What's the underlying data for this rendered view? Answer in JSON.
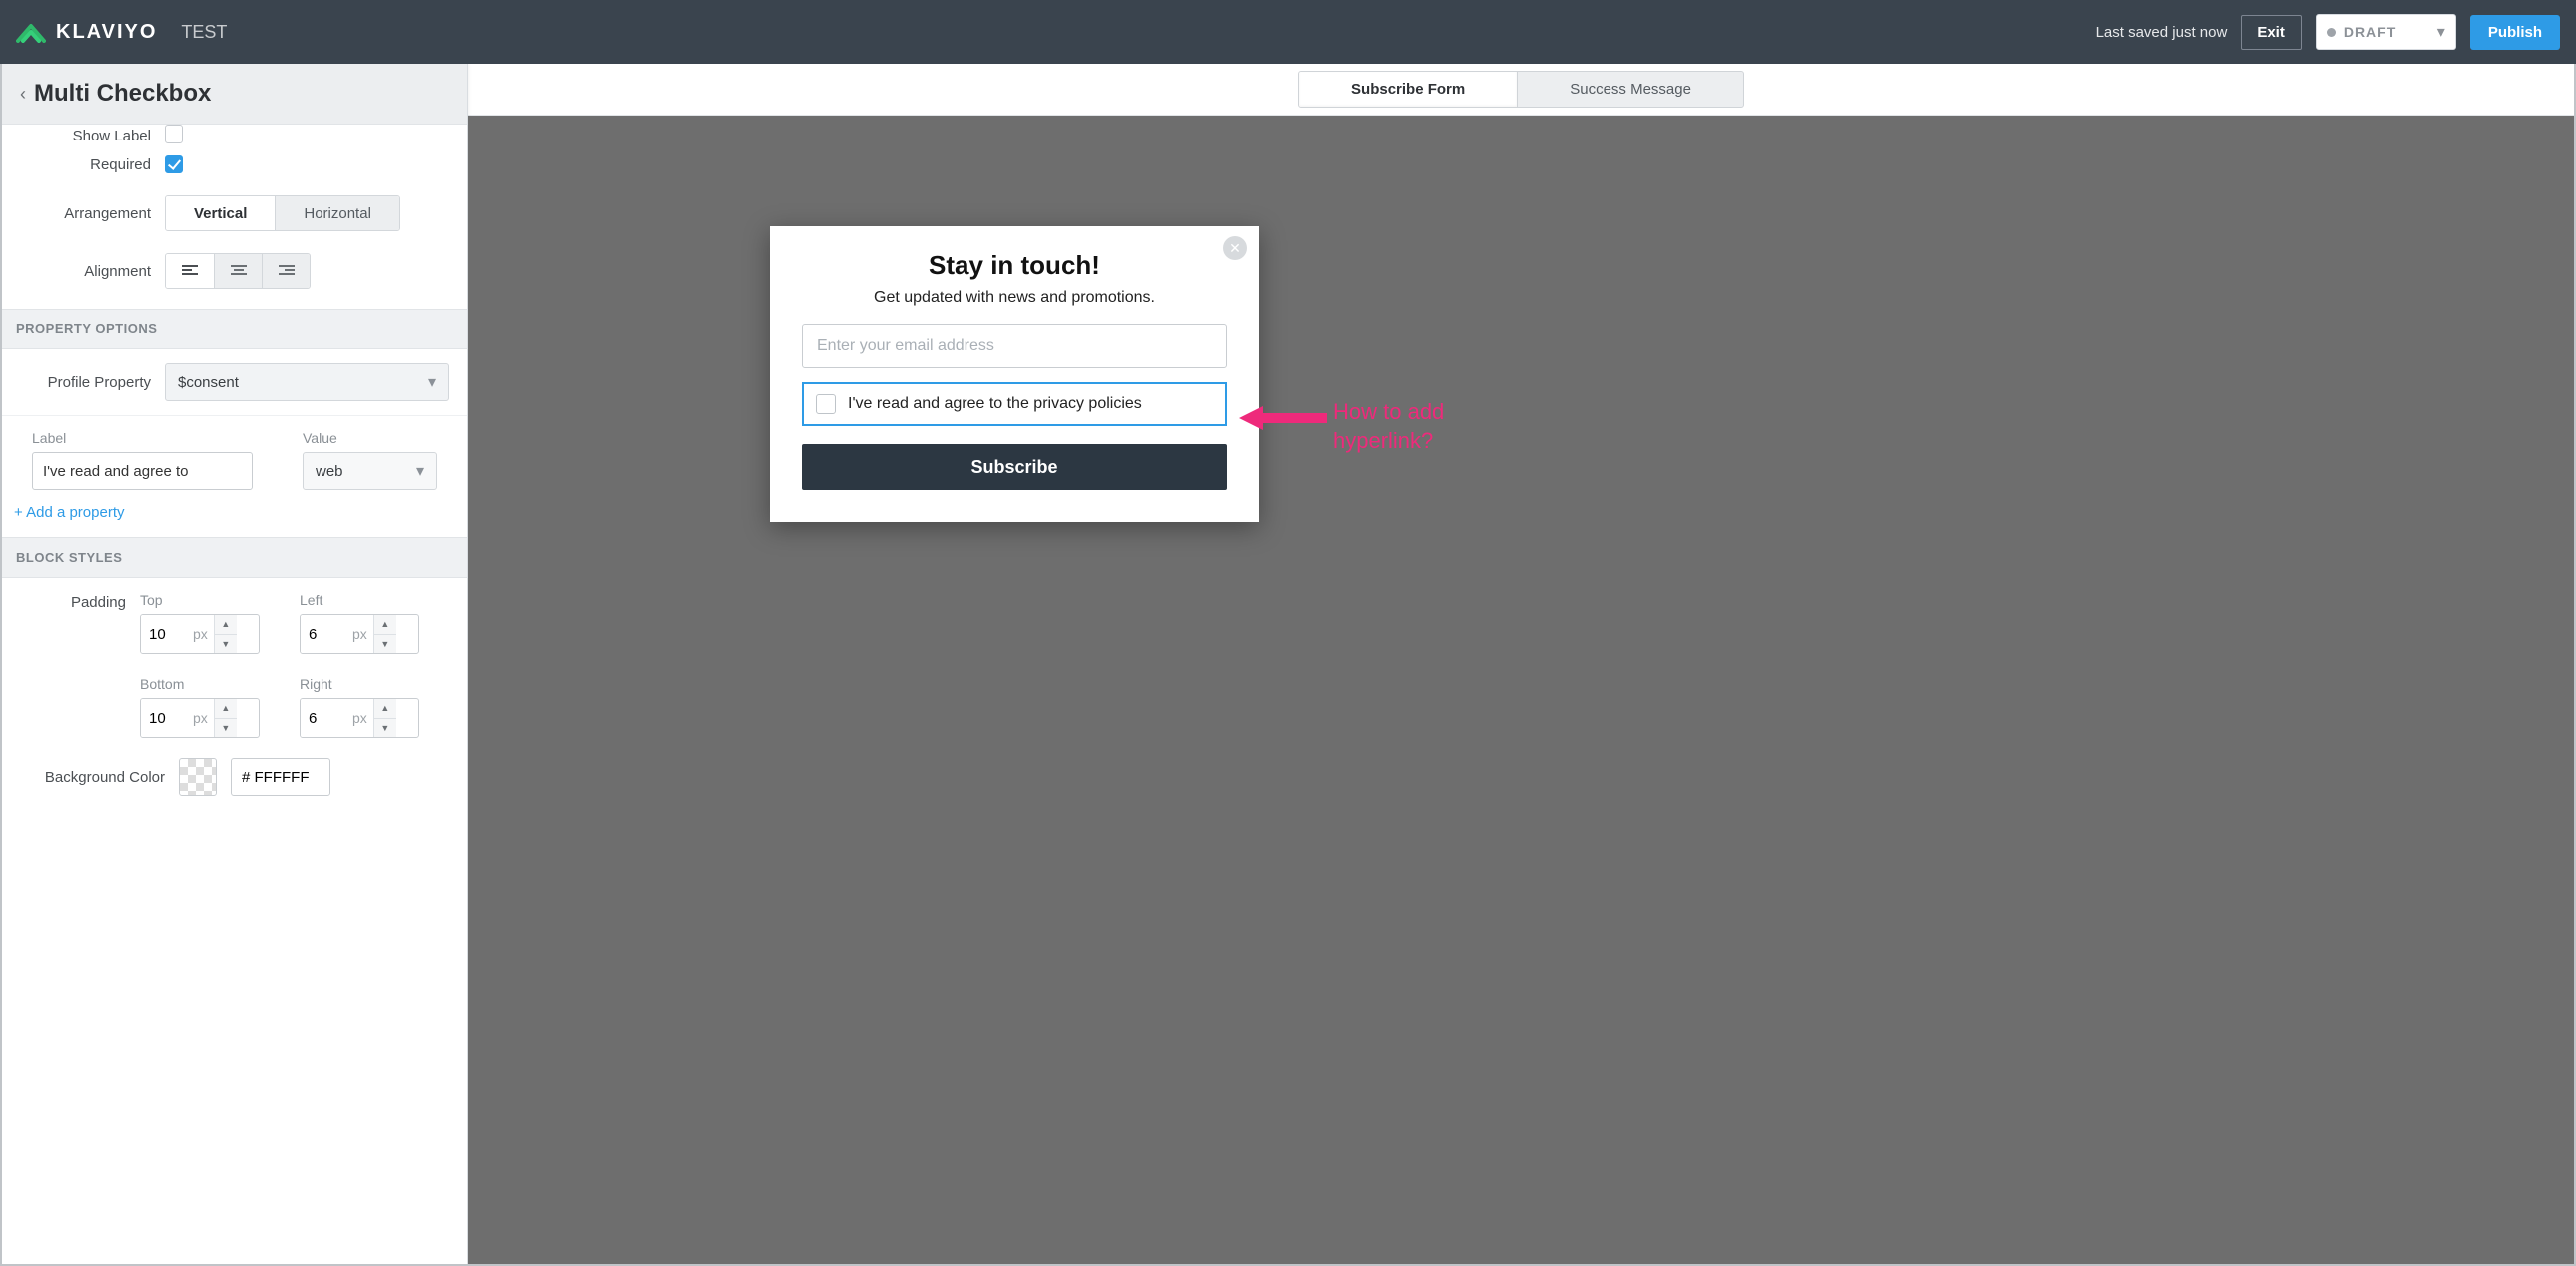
{
  "header": {
    "brand": "KLAVIYO",
    "project": "TEST",
    "last_saved": "Last saved just now",
    "exit": "Exit",
    "status": "DRAFT",
    "publish": "Publish"
  },
  "sidebar": {
    "title": "Multi Checkbox",
    "fields": {
      "show_label": "Show Label",
      "required": "Required",
      "arrangement": "Arrangement",
      "arrangement_options": {
        "vertical": "Vertical",
        "horizontal": "Horizontal"
      },
      "alignment": "Alignment"
    },
    "section_property_options": "PROPERTY OPTIONS",
    "profile_property_label": "Profile Property",
    "profile_property_value": "$consent",
    "label_label": "Label",
    "label_value": "I've read and agree to",
    "value_label": "Value",
    "value_value": "web",
    "add_property": "+ Add a property",
    "section_block_styles": "BLOCK STYLES",
    "padding_label": "Padding",
    "pad": {
      "top_label": "Top",
      "top": "10",
      "left_label": "Left",
      "left": "6",
      "bottom_label": "Bottom",
      "bottom": "10",
      "right_label": "Right",
      "right": "6",
      "unit": "px"
    },
    "bg_color_label": "Background Color",
    "bg_color_value": "# FFFFFF"
  },
  "preview": {
    "tabs": {
      "subscribe": "Subscribe Form",
      "success": "Success Message"
    },
    "modal": {
      "title": "Stay in touch!",
      "subtitle": "Get updated with news and promotions.",
      "email_placeholder": "Enter your email address",
      "consent": "I've read and agree to the privacy policies",
      "subscribe": "Subscribe"
    },
    "annotation": "How to add hyperlink?"
  }
}
